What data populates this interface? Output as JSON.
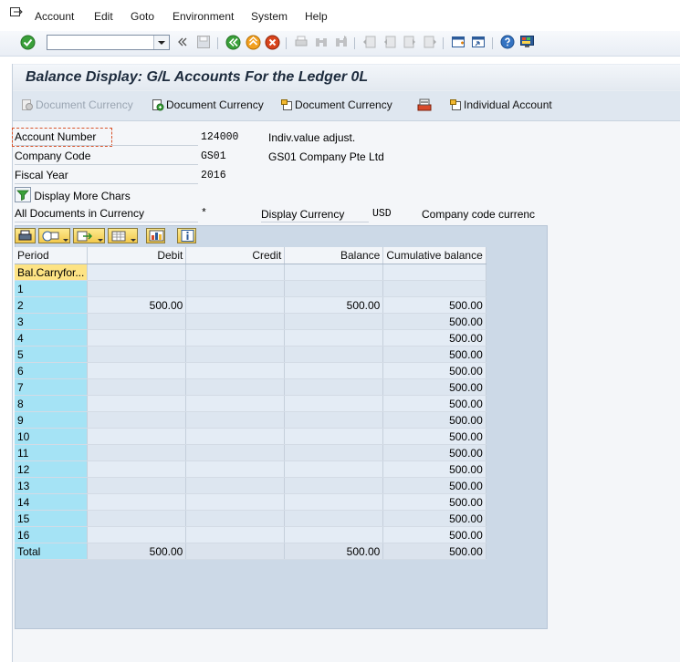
{
  "menu": {
    "items": [
      "Account",
      "Edit",
      "Goto",
      "Environment",
      "System",
      "Help"
    ]
  },
  "toolbar": {
    "command_value": "",
    "icons": [
      "enter-icon",
      "back-nav-icon",
      "save-icon",
      "back-icon",
      "exit-icon",
      "cancel-icon",
      "print-icon",
      "find-icon",
      "find-next-icon",
      "first-page-icon",
      "previous-page-icon",
      "next-page-icon",
      "last-page-icon",
      "create-session-icon",
      "shortcut-icon",
      "help-icon",
      "customize-layout-icon"
    ]
  },
  "title": "Balance Display: G/L Accounts For the Ledger 0L",
  "app_toolbar": {
    "btn1": "Document Currency",
    "btn2": "Document Currency",
    "btn3": "Document Currency",
    "btn5": "Individual Account"
  },
  "form": {
    "account_number_label": "Account Number",
    "account_number_value": "124000",
    "account_text": "Indiv.value adjust.",
    "company_code_label": "Company Code",
    "company_code_value": "GS01",
    "company_text": "GS01 Company Pte Ltd",
    "fiscal_year_label": "Fiscal Year",
    "fiscal_year_value": "2016",
    "display_more": "Display More Chars",
    "all_docs_label": "All Documents in Currency",
    "all_docs_value": "*",
    "display_currency_label": "Display Currency",
    "display_currency_value": "USD",
    "company_code_currency": "Company code currenc"
  },
  "grid": {
    "headers": {
      "period": "Period",
      "debit": "Debit",
      "credit": "Credit",
      "balance": "Balance",
      "cumulative": "Cumulative balance"
    },
    "rows": [
      {
        "period": "Bal.Carryfor...",
        "debit": "",
        "credit": "",
        "balance": "",
        "cumulative": ""
      },
      {
        "period": "1",
        "debit": "",
        "credit": "",
        "balance": "",
        "cumulative": ""
      },
      {
        "period": "2",
        "debit": "500.00",
        "credit": "",
        "balance": "500.00",
        "cumulative": "500.00"
      },
      {
        "period": "3",
        "debit": "",
        "credit": "",
        "balance": "",
        "cumulative": "500.00"
      },
      {
        "period": "4",
        "debit": "",
        "credit": "",
        "balance": "",
        "cumulative": "500.00"
      },
      {
        "period": "5",
        "debit": "",
        "credit": "",
        "balance": "",
        "cumulative": "500.00"
      },
      {
        "period": "6",
        "debit": "",
        "credit": "",
        "balance": "",
        "cumulative": "500.00"
      },
      {
        "period": "7",
        "debit": "",
        "credit": "",
        "balance": "",
        "cumulative": "500.00"
      },
      {
        "period": "8",
        "debit": "",
        "credit": "",
        "balance": "",
        "cumulative": "500.00"
      },
      {
        "period": "9",
        "debit": "",
        "credit": "",
        "balance": "",
        "cumulative": "500.00"
      },
      {
        "period": "10",
        "debit": "",
        "credit": "",
        "balance": "",
        "cumulative": "500.00"
      },
      {
        "period": "11",
        "debit": "",
        "credit": "",
        "balance": "",
        "cumulative": "500.00"
      },
      {
        "period": "12",
        "debit": "",
        "credit": "",
        "balance": "",
        "cumulative": "500.00"
      },
      {
        "period": "13",
        "debit": "",
        "credit": "",
        "balance": "",
        "cumulative": "500.00"
      },
      {
        "period": "14",
        "debit": "",
        "credit": "",
        "balance": "",
        "cumulative": "500.00"
      },
      {
        "period": "15",
        "debit": "",
        "credit": "",
        "balance": "",
        "cumulative": "500.00"
      },
      {
        "period": "16",
        "debit": "",
        "credit": "",
        "balance": "",
        "cumulative": "500.00"
      },
      {
        "period": "Total",
        "debit": "500.00",
        "credit": "",
        "balance": "500.00",
        "cumulative": "500.00"
      }
    ]
  },
  "colors": {
    "period_column": "#a5e3f5",
    "selected_cell": "#fde384",
    "grid_background": "#ccd9e7"
  }
}
